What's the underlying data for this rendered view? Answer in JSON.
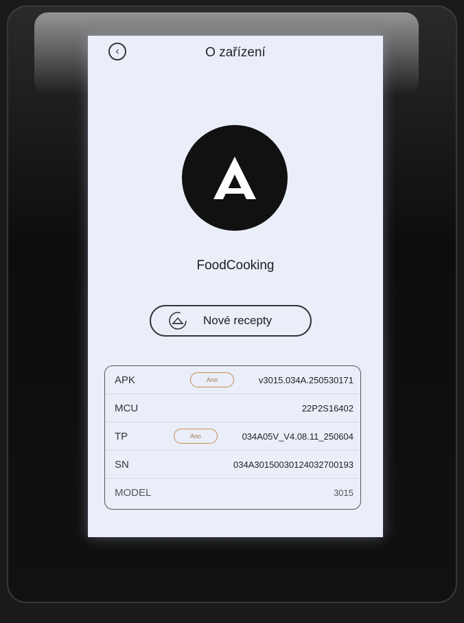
{
  "header": {
    "title": "O zařízení",
    "back_icon": "chevron-left-icon"
  },
  "app": {
    "logo_letter": "A",
    "name": "FoodCooking"
  },
  "recipes_button": {
    "label": "Nové recepty",
    "icon": "refresh-icon"
  },
  "info": {
    "apk": {
      "key": "APK",
      "badge": "Ano",
      "value": "v3015.034A.250530171"
    },
    "mcu": {
      "key": "MCU",
      "value": "22P2S16402"
    },
    "tp": {
      "key": "TP",
      "badge": "Ano",
      "value": "034A05V_V4.08.11_250604"
    },
    "sn": {
      "key": "SN",
      "value": "034A30150030124032700193"
    },
    "model": {
      "key": "MODEL",
      "value": "3015"
    }
  },
  "colors": {
    "screen_bg": "#e9eef9",
    "badge_border": "#c98a47",
    "logo_bg": "#111111"
  }
}
